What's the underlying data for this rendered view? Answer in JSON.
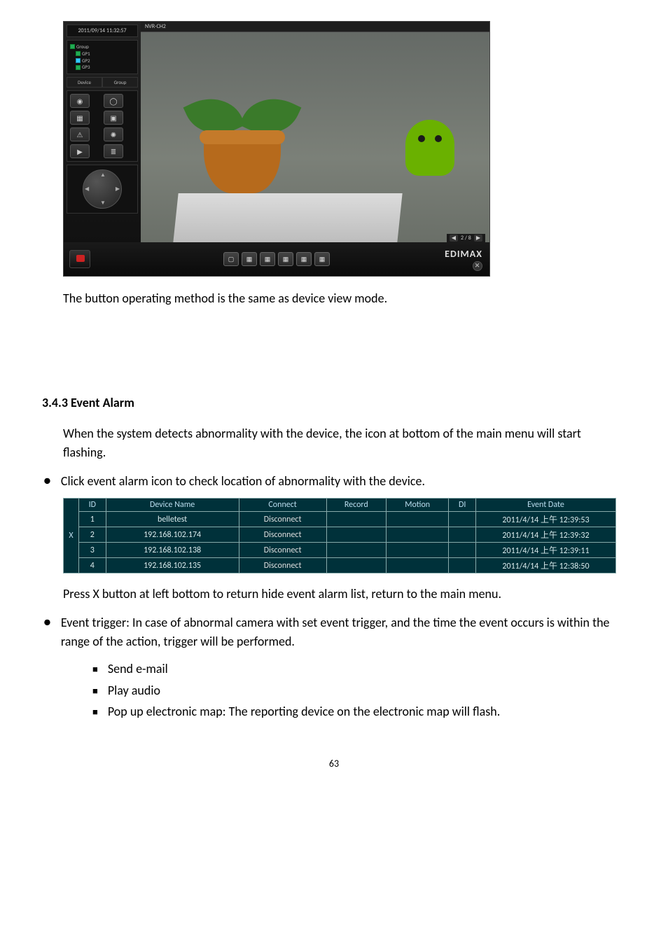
{
  "nvr": {
    "timestamp": "2011/09/14 11:32:57",
    "tree": {
      "root": "Group",
      "items": [
        "GP1",
        "GP2",
        "GP3"
      ]
    },
    "tabs": {
      "device": "Device",
      "group": "Group"
    },
    "side_icons": {
      "snapshot": "snapshot-icon",
      "record": "record-icon",
      "grid4": "grid4-icon",
      "grid1": "grid1-icon",
      "warn": "warn-icon",
      "gear": "gear-icon",
      "play": "play-icon",
      "list": "list-icon"
    },
    "channel_label": "NVR-CH2",
    "pager": {
      "value": "2 / 8"
    },
    "brand": "EDIMAX"
  },
  "para_caption": "The button operating method is the same as device view mode.",
  "section_title": "3.4.3 Event Alarm",
  "section_intro": "When the system detects abnormality with the device, the icon at bottom of the main menu will start flashing.",
  "bullet_click": "Click event alarm icon to check location of abnormality with the device.",
  "event_table": {
    "close_label": "X",
    "headers": {
      "id": "ID",
      "device": "Device Name",
      "connect": "Connect",
      "record": "Record",
      "motion": "Motion",
      "di": "DI",
      "date": "Event Date"
    },
    "rows": [
      {
        "id": "1",
        "device": "belletest",
        "connect": "Disconnect",
        "record": "",
        "motion": "",
        "di": "",
        "date": "2011/4/14 上午 12:39:53"
      },
      {
        "id": "2",
        "device": "192.168.102.174",
        "connect": "Disconnect",
        "record": "",
        "motion": "",
        "di": "",
        "date": "2011/4/14 上午 12:39:32"
      },
      {
        "id": "3",
        "device": "192.168.102.138",
        "connect": "Disconnect",
        "record": "",
        "motion": "",
        "di": "",
        "date": "2011/4/14 上午 12:39:11"
      },
      {
        "id": "4",
        "device": "192.168.102.135",
        "connect": "Disconnect",
        "record": "",
        "motion": "",
        "di": "",
        "date": "2011/4/14 上午 12:38:50"
      }
    ]
  },
  "para_pressx": "Press X button at left bottom to return hide event alarm list, return to the main menu.",
  "bullet_trigger": "Event trigger: In case of abnormal camera with set event trigger, and the time the event occurs is within the range of the action, trigger will be performed.",
  "sub_bullets": {
    "a": "Send e-mail",
    "b": "Play audio",
    "c": "Pop up electronic map: The reporting device on the electronic map will flash."
  },
  "page_number": "63"
}
